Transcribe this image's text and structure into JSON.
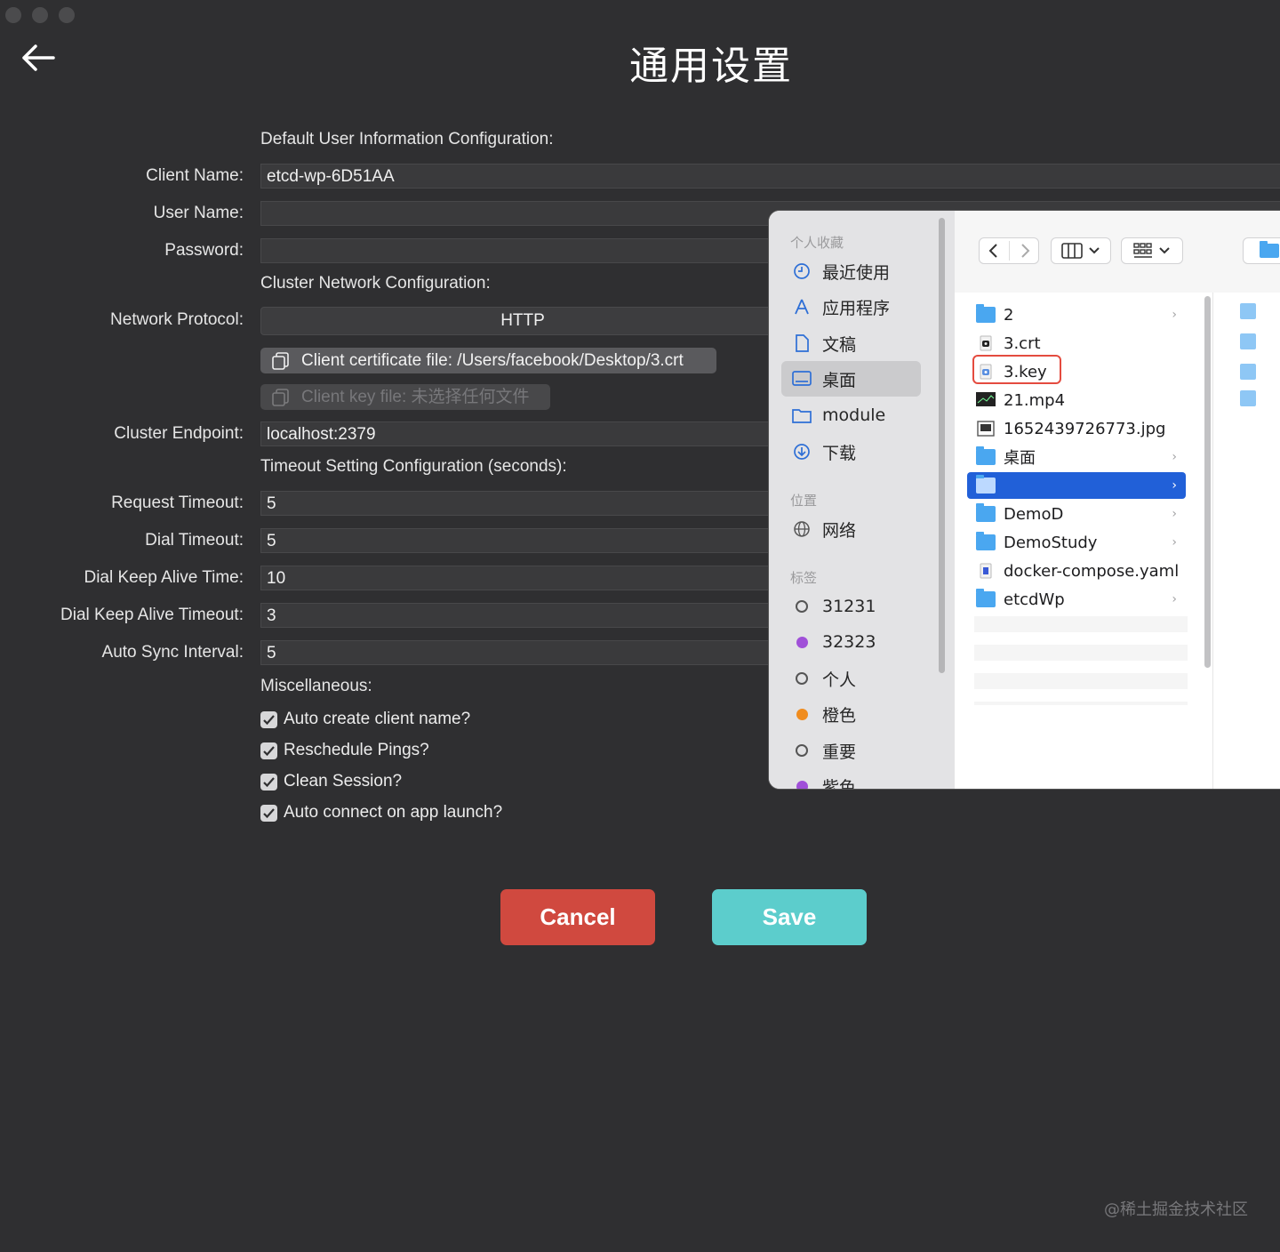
{
  "window": {
    "title": "通用设置"
  },
  "sections": {
    "user_info": "Default User Information Configuration:",
    "network": "Cluster Network Configuration:",
    "timeout": "Timeout Setting Configuration (seconds):",
    "misc": "Miscellaneous:"
  },
  "fields": {
    "client_name": {
      "label": "Client Name:",
      "value": "etcd-wp-6D51AA"
    },
    "user_name": {
      "label": "User Name:",
      "value": ""
    },
    "password": {
      "label": "Password:",
      "value": ""
    },
    "network_protocol": {
      "label": "Network Protocol:",
      "value": "HTTP"
    },
    "client_cert": "Client certificate file: /Users/facebook/Desktop/3.crt",
    "client_key": "Client key file: 未选择任何文件",
    "cluster_endpoint": {
      "label": "Cluster Endpoint:",
      "value": "localhost:2379"
    },
    "request_timeout": {
      "label": "Request Timeout:",
      "value": "5"
    },
    "dial_timeout": {
      "label": "Dial Timeout:",
      "value": "5"
    },
    "dial_keep_alive_time": {
      "label": "Dial Keep Alive Time:",
      "value": "10"
    },
    "dial_keep_alive_timeout": {
      "label": "Dial Keep Alive Timeout:",
      "value": "3"
    },
    "auto_sync_interval": {
      "label": "Auto Sync Interval:",
      "value": "5"
    }
  },
  "checkboxes": [
    {
      "label": "Auto create client name?",
      "checked": true
    },
    {
      "label": "Reschedule Pings?",
      "checked": true
    },
    {
      "label": "Clean Session?",
      "checked": true
    },
    {
      "label": "Auto connect on app launch?",
      "checked": true
    }
  ],
  "buttons": {
    "cancel": "Cancel",
    "save": "Save"
  },
  "watermark": "@稀土掘金技术社区",
  "finder": {
    "sidebar": {
      "favorites_header": "个人收藏",
      "favorites": [
        {
          "label": "最近使用",
          "icon": "clock-icon"
        },
        {
          "label": "应用程序",
          "icon": "apps-icon"
        },
        {
          "label": "文稿",
          "icon": "document-icon"
        },
        {
          "label": "桌面",
          "icon": "desktop-icon",
          "selected": true
        },
        {
          "label": "module",
          "icon": "folder-icon"
        },
        {
          "label": "下载",
          "icon": "download-icon"
        }
      ],
      "locations_header": "位置",
      "locations": [
        {
          "label": "网络",
          "icon": "globe-icon"
        }
      ],
      "tags_header": "标签",
      "tags": [
        {
          "label": "31231",
          "color": "hollow"
        },
        {
          "label": "32323",
          "color": "#a050d8"
        },
        {
          "label": "个人",
          "color": "hollow"
        },
        {
          "label": "橙色",
          "color": "#f08c1e"
        },
        {
          "label": "重要",
          "color": "hollow"
        },
        {
          "label": "紫色",
          "color": "#a050d8"
        }
      ]
    },
    "files": [
      {
        "name": "2",
        "type": "folder",
        "chevron": true
      },
      {
        "name": "3.crt",
        "type": "cert"
      },
      {
        "name": "3.key",
        "type": "key",
        "highlighted": true
      },
      {
        "name": "21.mp4",
        "type": "video"
      },
      {
        "name": "1652439726773.jpg",
        "type": "image"
      },
      {
        "name": "桌面",
        "type": "folder",
        "chevron": true
      },
      {
        "name": "",
        "type": "folder",
        "chevron": true,
        "selected": true
      },
      {
        "name": "DemoD",
        "type": "folder",
        "chevron": true
      },
      {
        "name": "DemoStudy",
        "type": "folder",
        "chevron": true
      },
      {
        "name": "docker-compose.yaml",
        "type": "yaml"
      },
      {
        "name": "etcdWp",
        "type": "folder",
        "chevron": true
      }
    ]
  }
}
